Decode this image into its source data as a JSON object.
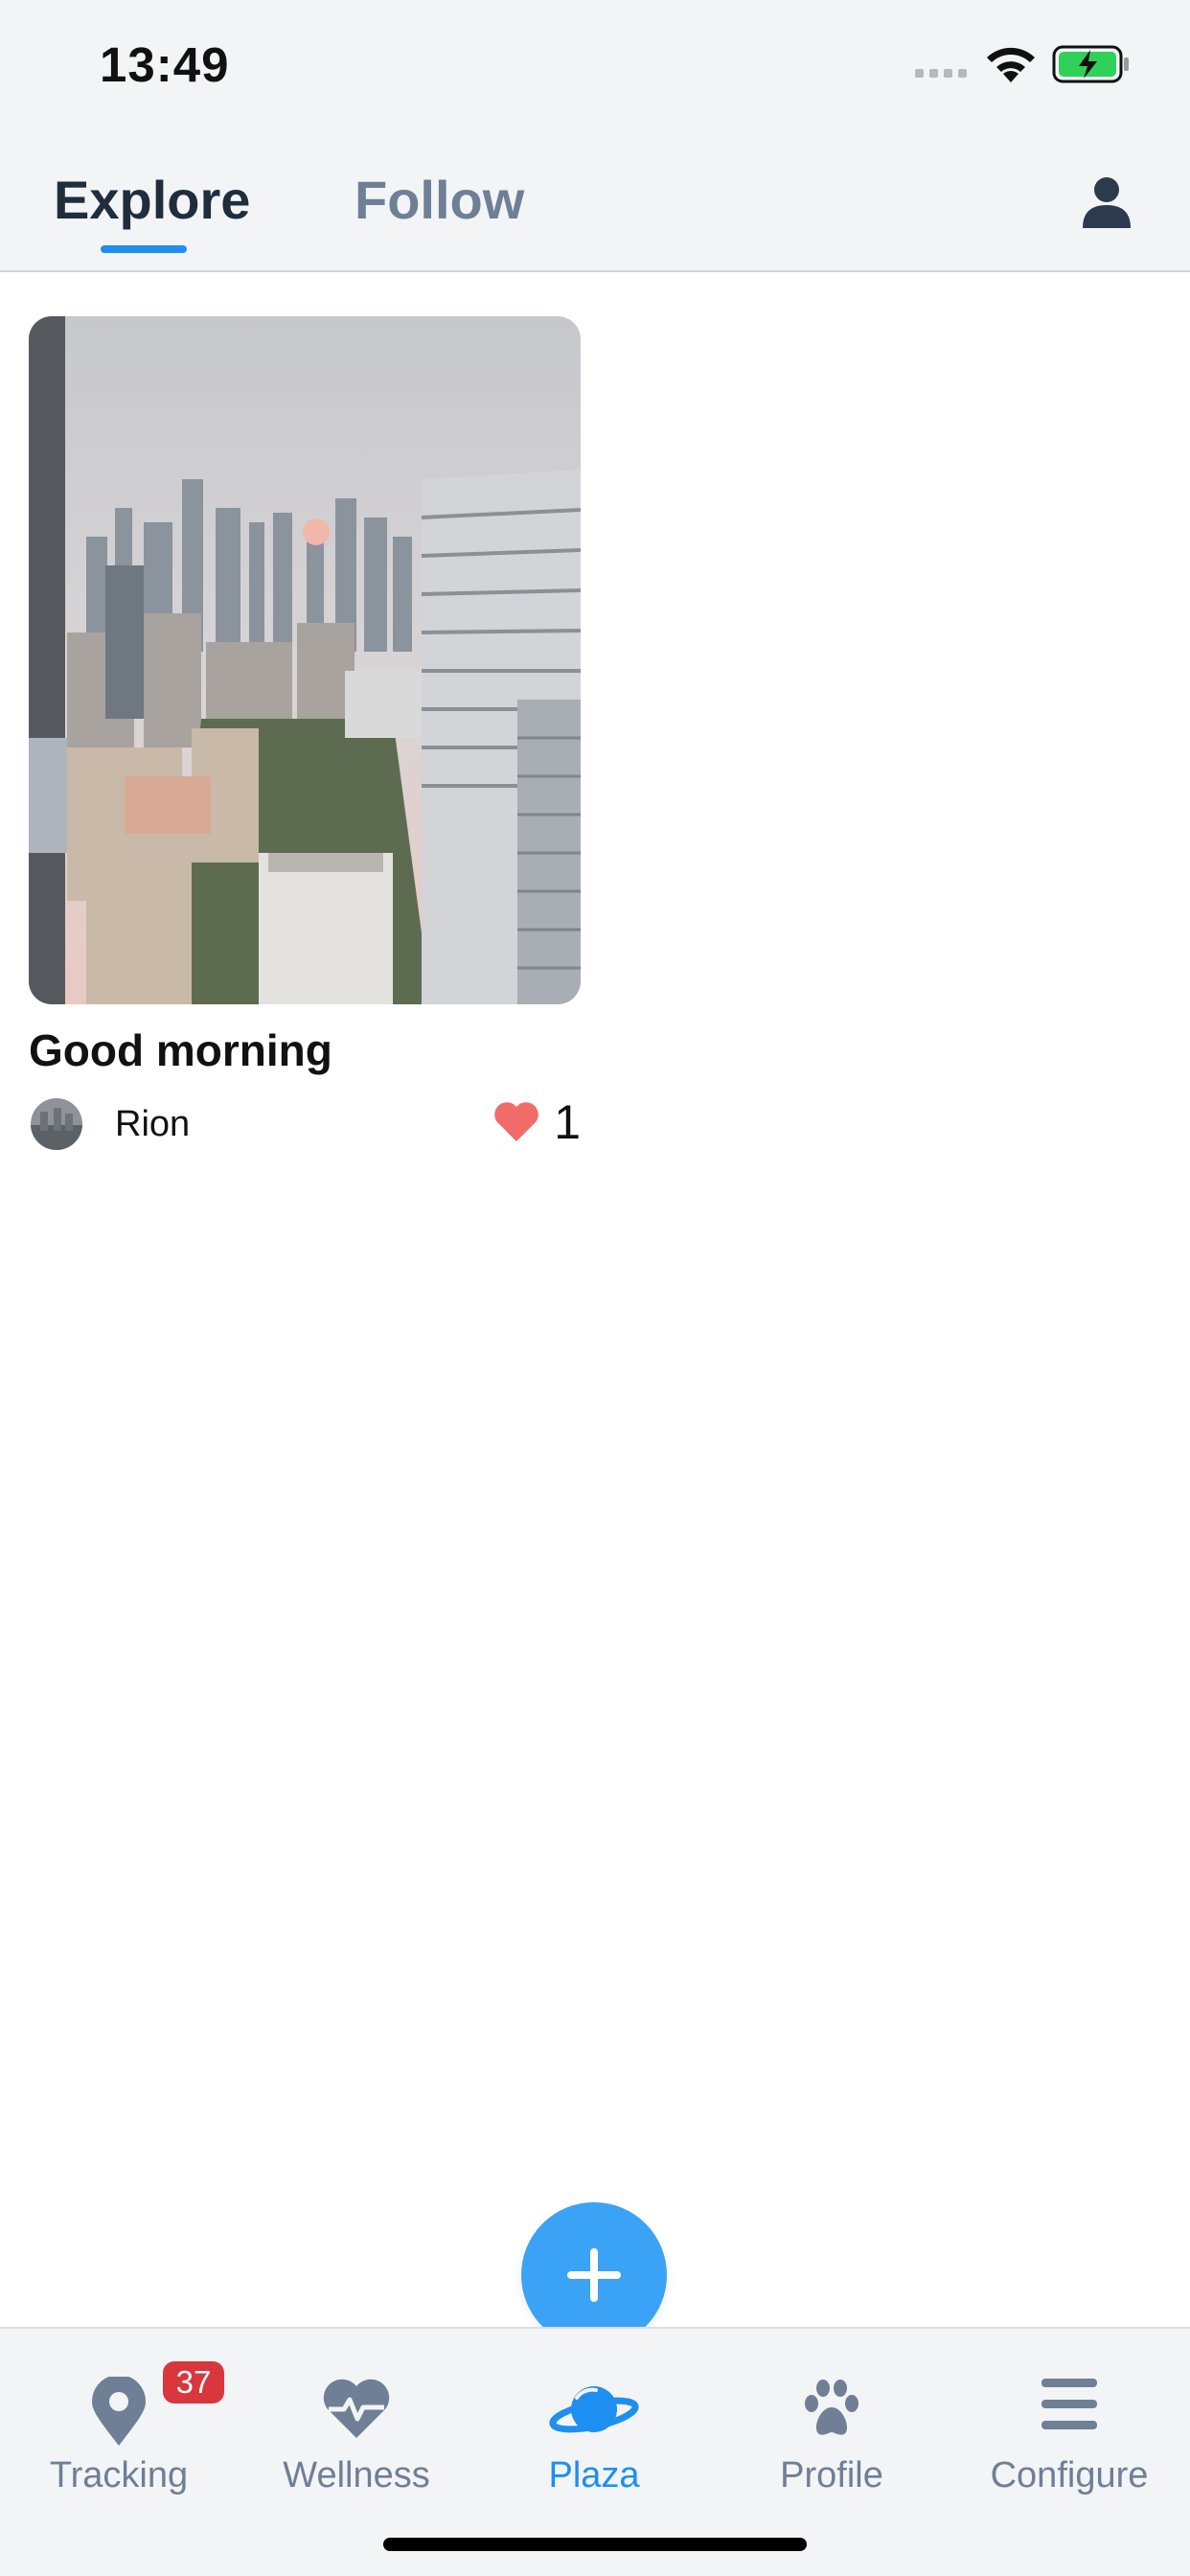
{
  "status_bar": {
    "time": "13:49"
  },
  "top_tabs": {
    "explore": "Explore",
    "follow": "Follow",
    "active": "Explore"
  },
  "feed": {
    "posts": [
      {
        "title": "Good morning",
        "author": "Rion",
        "likes": "1",
        "image": "city-skyline-photo"
      }
    ]
  },
  "tab_bar": {
    "items": [
      {
        "label": "Tracking",
        "icon": "map-pin-icon",
        "badge": "37"
      },
      {
        "label": "Wellness",
        "icon": "heart-pulse-icon"
      },
      {
        "label": "Plaza",
        "icon": "planet-icon",
        "active": true
      },
      {
        "label": "Profile",
        "icon": "paw-icon"
      },
      {
        "label": "Configure",
        "icon": "menu-icon"
      }
    ]
  },
  "colors": {
    "accent": "#1e8ff0",
    "fab": "#3aa3f5",
    "inactive": "#6e7f96",
    "heart": "#f26b6b",
    "badge": "#d9363e"
  }
}
